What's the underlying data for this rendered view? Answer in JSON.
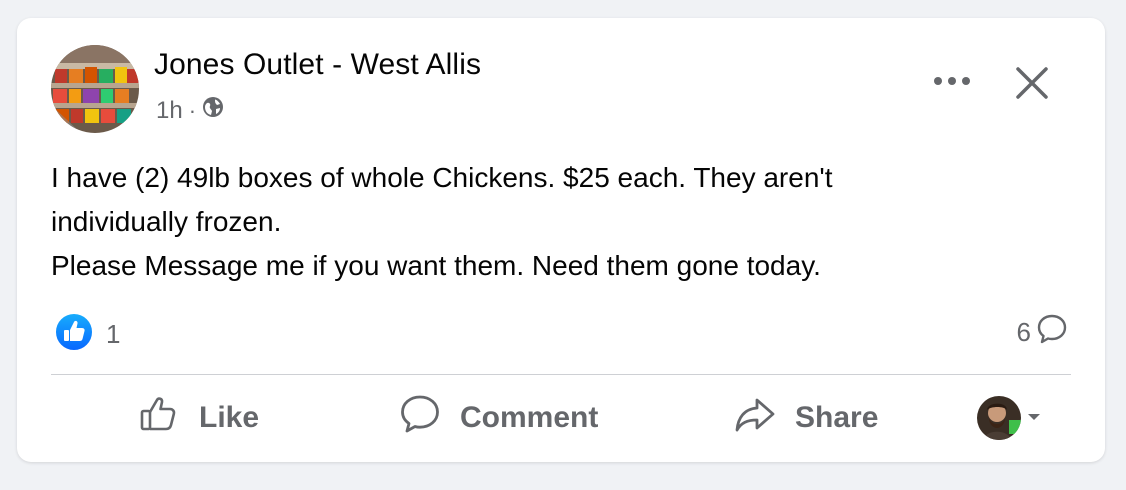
{
  "post": {
    "author": "Jones Outlet - West Allis",
    "time": "1h",
    "time_separator": "·",
    "audience_icon": "globe-icon",
    "body_lines": [
      "I have (2) 49lb boxes of whole Chickens. $25 each. They aren't",
      "individually frozen.",
      "Please Message me if you want them. Need them gone today."
    ],
    "reactions": {
      "icon": "like-reaction-icon",
      "count": "1",
      "color": "#1877f2"
    },
    "comments": {
      "count": "6",
      "icon": "comment-icon"
    }
  },
  "actions": {
    "like_label": "Like",
    "comment_label": "Comment",
    "share_label": "Share"
  },
  "header_icons": {
    "more": "more-options-icon",
    "close": "close-icon"
  },
  "colors": {
    "page_background": "#f0f2f5",
    "card_background": "#ffffff",
    "primary_text": "#050505",
    "secondary_text": "#65676b",
    "like_blue": "#1877f2"
  }
}
